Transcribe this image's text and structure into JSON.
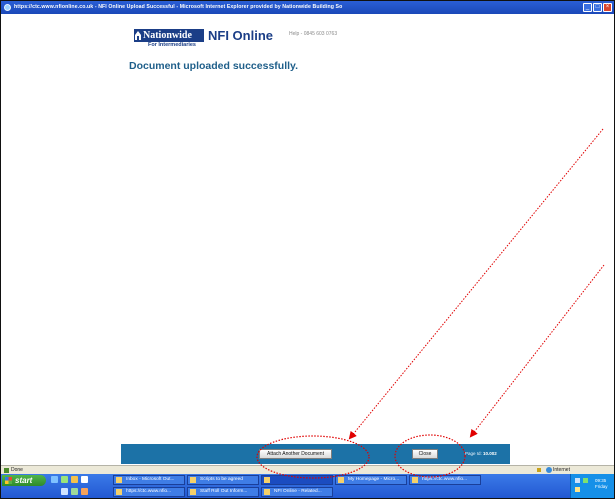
{
  "window": {
    "title": "https://ctc.www.nfionline.co.uk - NFI Online Upload Successful - Microsoft Internet Explorer provided by Nationwide Building So",
    "controls": [
      "_",
      "□",
      "×"
    ]
  },
  "header": {
    "logo_brand": "Nationwide",
    "logo_sub": "For Intermediaries",
    "product": "NFI Online",
    "helpline": "Help - 0845 603 0763"
  },
  "main": {
    "message": "Document uploaded successfully."
  },
  "actions": {
    "attach_label": "Attach Another Document",
    "close_label": "Close",
    "page_id_label": "Page Id:",
    "page_id_value": "10.002"
  },
  "statusbar": {
    "left": "Done",
    "zone": "Internet"
  },
  "taskbar": {
    "start_label": "start",
    "tasks_row1": [
      "Inbox - Microsoft Out...",
      "Scripts to be agreed",
      "",
      "My Homepage - Micro...",
      "https://ctc.www.nfio..."
    ],
    "tasks_row2": [
      "https://ctc.www.nfio...",
      "Staff Roll Out Inform...",
      "NFI Online - Related..."
    ],
    "clock": "09:35",
    "day": "Friday"
  },
  "colors": {
    "title_bar": "#1b48b8",
    "brand_navy": "#1b3e87",
    "headline": "#1f5f8a",
    "action_bar": "#1c72a7",
    "annotation": "#e00000",
    "taskbar": "#2157d1"
  },
  "icons": [
    "ie-icon",
    "nationwide-house-logo",
    "page-icon",
    "lock-icon",
    "internet-globe-icon",
    "windows-flag-icon"
  ]
}
